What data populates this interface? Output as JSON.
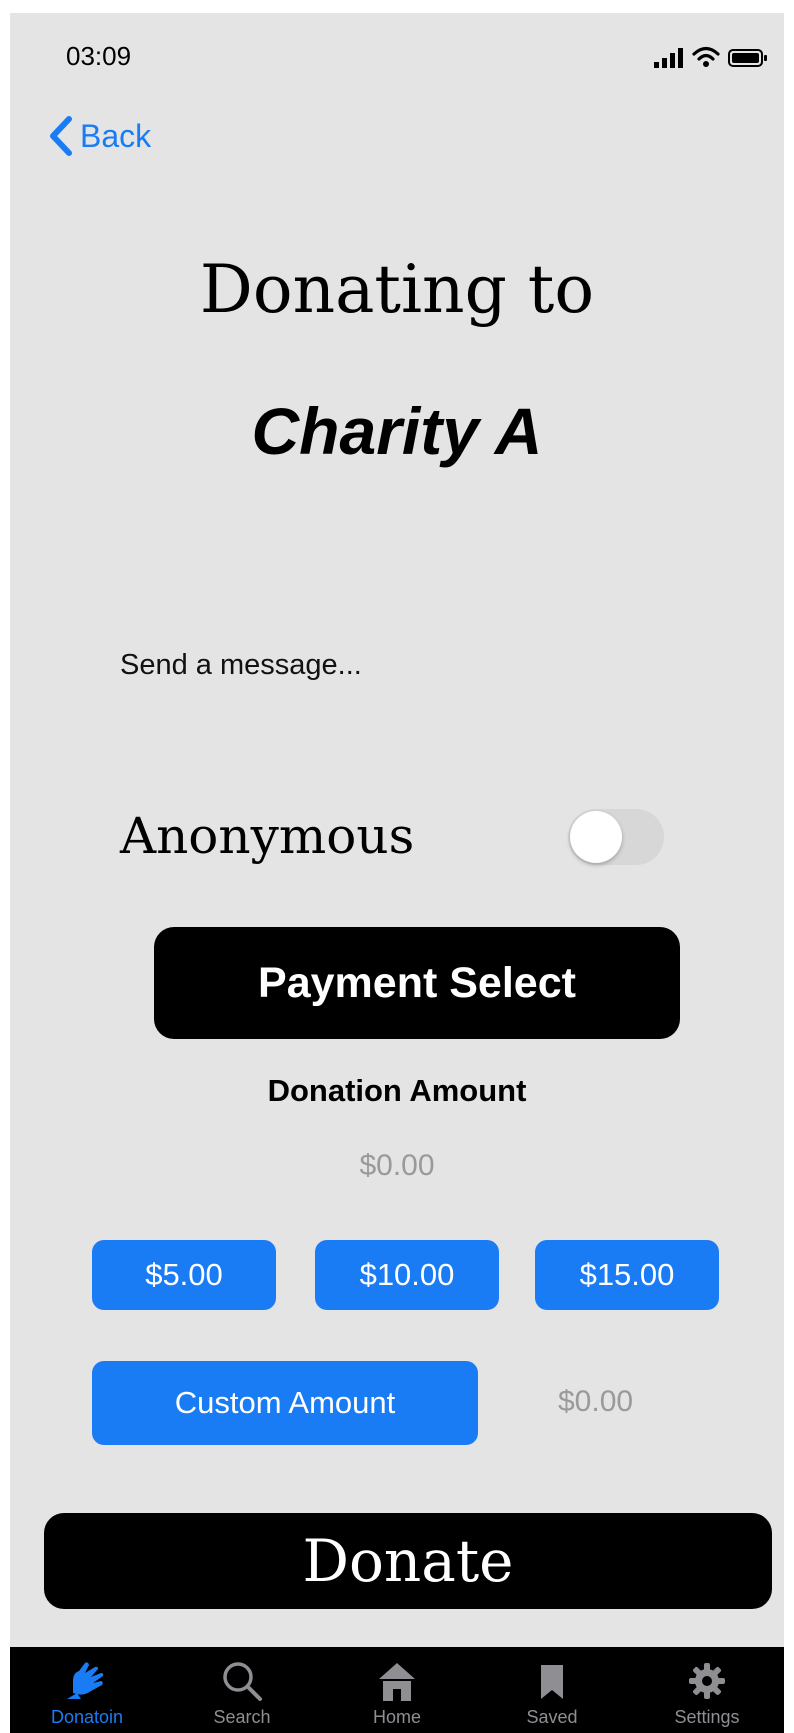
{
  "status_bar": {
    "time": "03:09"
  },
  "nav": {
    "back_label": "Back"
  },
  "header": {
    "line1": "Donating to",
    "charity": "Charity A"
  },
  "message": {
    "placeholder": "Send a message..."
  },
  "anonymous": {
    "label": "Anonymous",
    "enabled": false
  },
  "payment": {
    "button_label": "Payment Select"
  },
  "donation": {
    "amount_label": "Donation Amount",
    "amount_value": "$0.00",
    "presets": [
      "$5.00",
      "$10.00",
      "$15.00"
    ],
    "custom_label": "Custom Amount",
    "custom_value": "$0.00"
  },
  "donate": {
    "button_label": "Donate"
  },
  "tabbar": {
    "tabs": [
      {
        "label": "Donatoin",
        "icon": "hands-icon",
        "active": true
      },
      {
        "label": "Search",
        "icon": "search-icon",
        "active": false
      },
      {
        "label": "Home",
        "icon": "home-icon",
        "active": false
      },
      {
        "label": "Saved",
        "icon": "bookmark-icon",
        "active": false
      },
      {
        "label": "Settings",
        "icon": "gear-icon",
        "active": false
      }
    ]
  },
  "colors": {
    "accent": "#1a7cf5",
    "background": "#e4e4e4",
    "inactive_tab": "#8e8e93"
  }
}
